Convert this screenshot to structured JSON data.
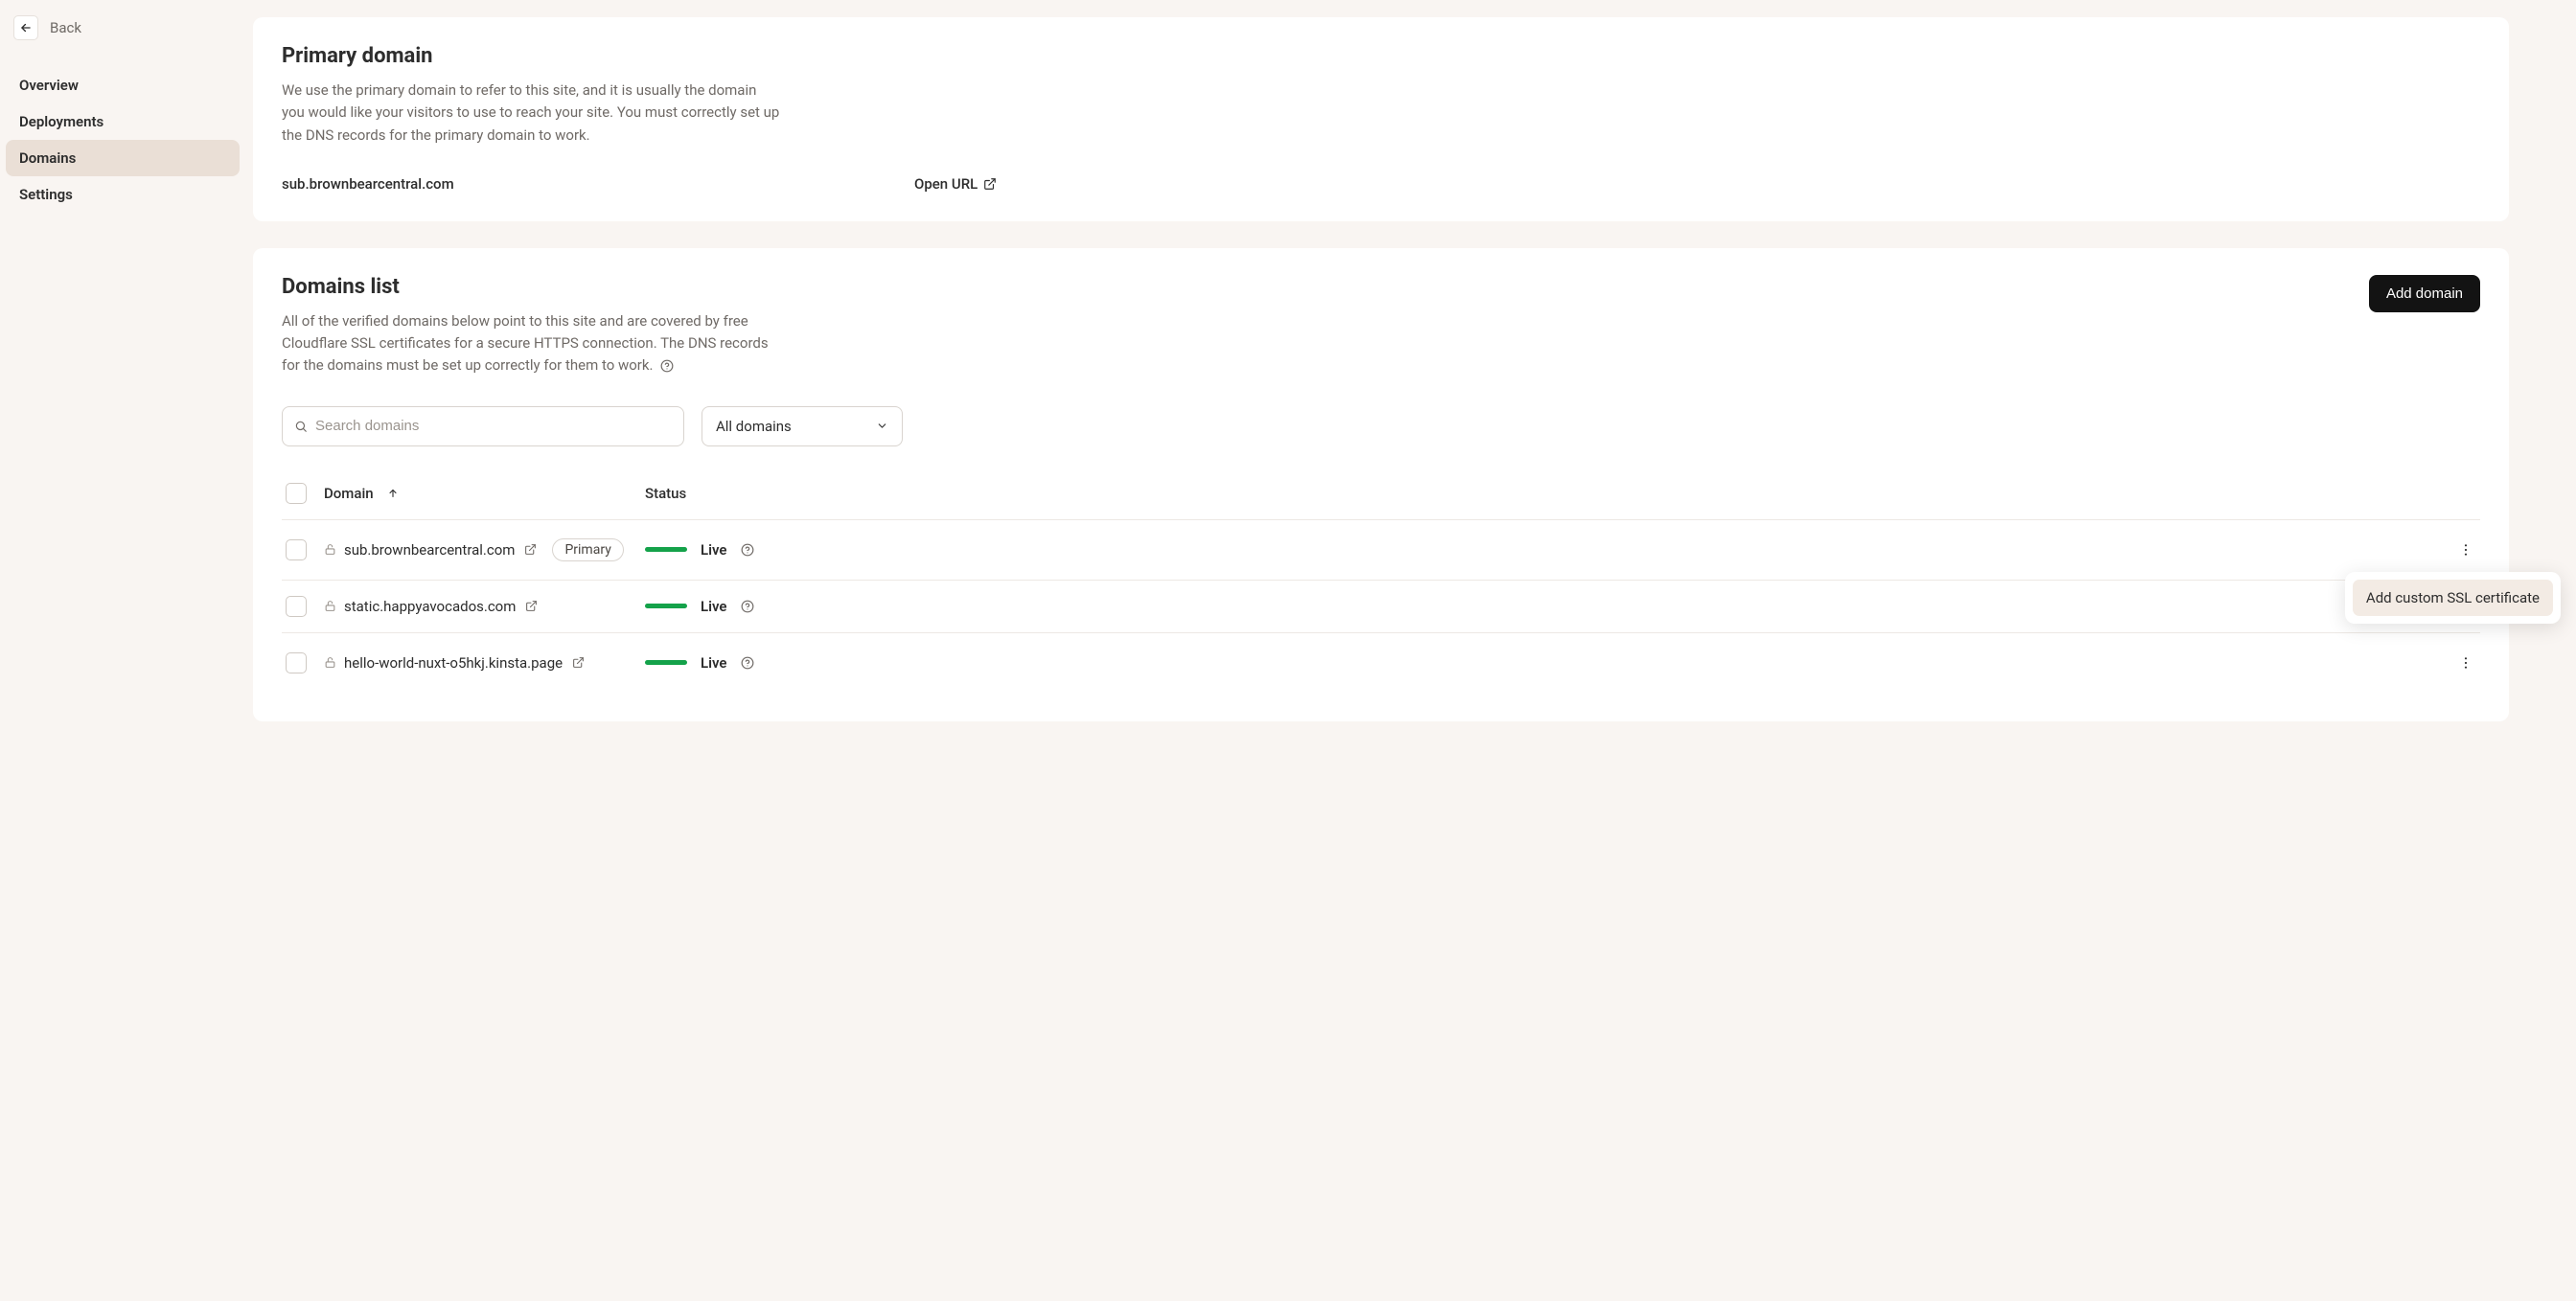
{
  "back": {
    "label": "Back"
  },
  "nav": {
    "items": [
      {
        "label": "Overview"
      },
      {
        "label": "Deployments"
      },
      {
        "label": "Domains"
      },
      {
        "label": "Settings"
      }
    ]
  },
  "primary": {
    "title": "Primary domain",
    "desc": "We use the primary domain to refer to this site, and it is usually the domain you would like your visitors to use to reach your site. You must correctly set up the DNS records for the primary domain to work.",
    "domain": "sub.brownbearcentral.com",
    "open_url_label": "Open URL"
  },
  "list": {
    "title": "Domains list",
    "desc": "All of the verified domains below point to this site and are covered by free Cloudflare SSL certificates for a secure HTTPS connection. The DNS records for the domains must be set up correctly for them to work.",
    "add_button": "Add domain",
    "search_placeholder": "Search domains",
    "filter_label": "All domains",
    "columns": {
      "domain": "Domain",
      "status": "Status"
    },
    "primary_badge": "Primary",
    "status_live": "Live",
    "popover": {
      "add_ssl": "Add custom SSL certificate"
    },
    "rows": [
      {
        "name": "sub.brownbearcentral.com",
        "primary": true,
        "status": "Live",
        "show_menu": true,
        "show_dots": true
      },
      {
        "name": "static.happyavocados.com",
        "primary": false,
        "status": "Live",
        "show_menu": false,
        "show_dots": false
      },
      {
        "name": "hello-world-nuxt-o5hkj.kinsta.page",
        "primary": false,
        "status": "Live",
        "show_menu": false,
        "show_dots": true
      }
    ]
  }
}
